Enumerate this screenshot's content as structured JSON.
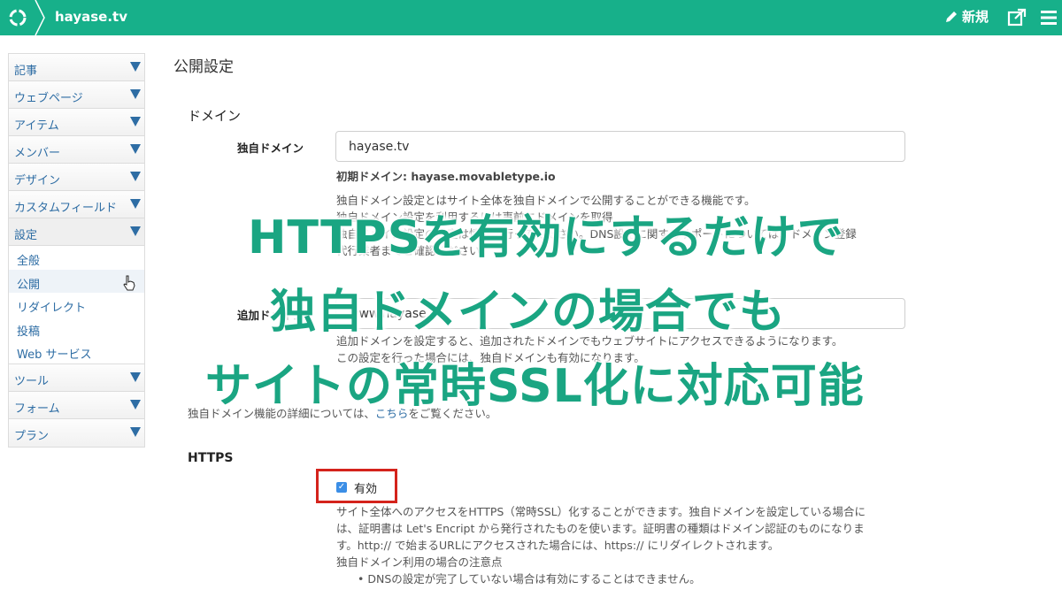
{
  "header": {
    "site_name": "hayase.tv",
    "new_label": "新規"
  },
  "sidebar": {
    "items": [
      {
        "label": "記事"
      },
      {
        "label": "ウェブページ"
      },
      {
        "label": "アイテム"
      },
      {
        "label": "メンバー"
      },
      {
        "label": "デザイン"
      },
      {
        "label": "カスタムフィールド"
      },
      {
        "label": "設定"
      }
    ],
    "settings_sub": [
      {
        "label": "全般"
      },
      {
        "label": "公開"
      },
      {
        "label": "リダイレクト"
      },
      {
        "label": "投稿"
      },
      {
        "label": "Web サービス"
      }
    ],
    "items_after": [
      {
        "label": "ツール"
      },
      {
        "label": "フォーム"
      },
      {
        "label": "プラン"
      }
    ]
  },
  "main": {
    "page_title": "公開設定",
    "domain_section": "ドメイン",
    "custom_domain_label": "独自ドメイン",
    "custom_domain_value": "hayase.tv",
    "initial_domain": "初期ドメイン: hayase.movabletype.io",
    "domain_help_1": "独自ドメイン設定とはサイト全体を独自ドメインで公開することができる機能です。",
    "domain_help_2": "独自ドメイン設定を利用するには事前にドメインを取得",
    "domain_help_3": "独自ドメイン設定の設定は慎重に行ってください。DNS設定に関するサポートについては、ドメイン登録",
    "domain_help_4": "代行業者までご確認ください。",
    "additional_label": "追加ドメイン",
    "additional_value": "www.hayase.tv",
    "additional_help_1": "追加ドメインを設定すると、追加されたドメインでもウェブサイトにアクセスできるようになります。",
    "additional_help_2": "この設定を行った場合には、独自ドメインも有効になります。",
    "details_prefix": "独自ドメイン機能の詳細については、",
    "details_link": "こちら",
    "details_suffix": "をご覧ください。",
    "https_section": "HTTPS",
    "https_checkbox_label": "有効",
    "https_help_1": "サイト全体へのアクセスをHTTPS（常時SSL）化することができます。独自ドメインを設定している場合に",
    "https_help_2": "は、証明書は Let's Encript から発行されたものを使います。証明書の種類はドメイン認証のものになりま",
    "https_help_3": "す。http:// で始まるURLにアクセスされた場合には、https:// にリダイレクトされます。",
    "https_help_4": "独自ドメイン利用の場合の注意点",
    "https_help_bullet": "DNSの設定が完了していない場合は有効にすることはできません。"
  },
  "overlay": {
    "line1": "HTTPSを有効にするだけで",
    "line2": "独自ドメインの場合でも",
    "line3": "サイトの常時SSL化に対応可能"
  },
  "colors": {
    "brand": "#17b08a",
    "overlay_text": "#1aa582",
    "highlight": "#d4231c",
    "link": "#2e6da4"
  }
}
